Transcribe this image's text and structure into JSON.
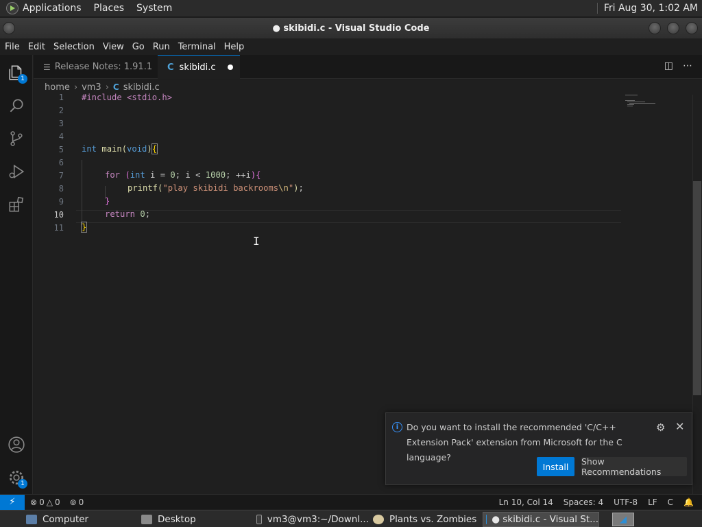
{
  "system_panel": {
    "menus": [
      "Applications",
      "Places",
      "System"
    ],
    "clock": "Fri Aug 30,  1:02 AM"
  },
  "window": {
    "title": "● skibidi.c - Visual Studio Code"
  },
  "menubar": {
    "items": [
      "File",
      "Edit",
      "Selection",
      "View",
      "Go",
      "Run",
      "Terminal",
      "Help"
    ]
  },
  "activity_bar": {
    "explorer_badge": "1",
    "manage_badge": "1"
  },
  "tabs": [
    {
      "label": "Release Notes: 1.91.1",
      "active": false
    },
    {
      "label": "skibidi.c",
      "active": true,
      "icon_letter": "C",
      "dirty": true
    }
  ],
  "breadcrumb": {
    "parts": [
      "home",
      "vm3"
    ],
    "file_icon": "C",
    "file": "skibidi.c"
  },
  "editor": {
    "line_numbers": [
      "1",
      "2",
      "3",
      "4",
      "5",
      "6",
      "7",
      "8",
      "9",
      "10",
      "11"
    ],
    "current_line": 10,
    "code": {
      "l1_include": "#include <stdio.h>",
      "l5_type": "int",
      "l5_name": " main",
      "l5_paren_open": "(",
      "l5_void": "void",
      "l5_paren_close": ")",
      "l5_brace": "{",
      "l7_for": "for",
      "l7_space": " ",
      "l7_paren_open": "(",
      "l7_int": "int",
      "l7_mid1": " i = ",
      "l7_zero": "0",
      "l7_mid2": "; i < ",
      "l7_limit": "1000",
      "l7_mid3": "; ++i",
      "l7_paren_close": ")",
      "l7_brace": "{",
      "l8_func": "printf",
      "l8_paren_open": "(",
      "l8_str1": "\"play skibidi backrooms",
      "l8_esc": "\\n",
      "l8_str2": "\"",
      "l8_paren_close": ")",
      "l8_semi": ";",
      "l9_brace": "}",
      "l10_return": "return",
      "l10_space": " ",
      "l10_zero": "0",
      "l10_semi": ";",
      "l11_brace": "}"
    }
  },
  "notification": {
    "message": "Do you want to install the recommended 'C/C++ Extension Pack' extension from Microsoft for the C language?",
    "install_label": "Install",
    "recommendations_label": "Show Recommendations"
  },
  "status_bar": {
    "errors": "0",
    "warnings": "0",
    "ports": "0",
    "position": "Ln 10, Col 14",
    "spaces": "Spaces: 4",
    "encoding": "UTF-8",
    "eol": "LF",
    "language": "C"
  },
  "taskbar": {
    "items": [
      "Computer",
      "Desktop",
      "vm3@vm3:~/Downl...",
      "Plants vs. Zombies",
      "● skibidi.c - Visual St..."
    ]
  },
  "colors": {
    "accent": "#0078d4",
    "editor_bg": "#1f1f1f",
    "keyword": "#569cd6",
    "control": "#c586c0",
    "function": "#dcdcaa",
    "string": "#ce9178",
    "number": "#b5cea8"
  }
}
